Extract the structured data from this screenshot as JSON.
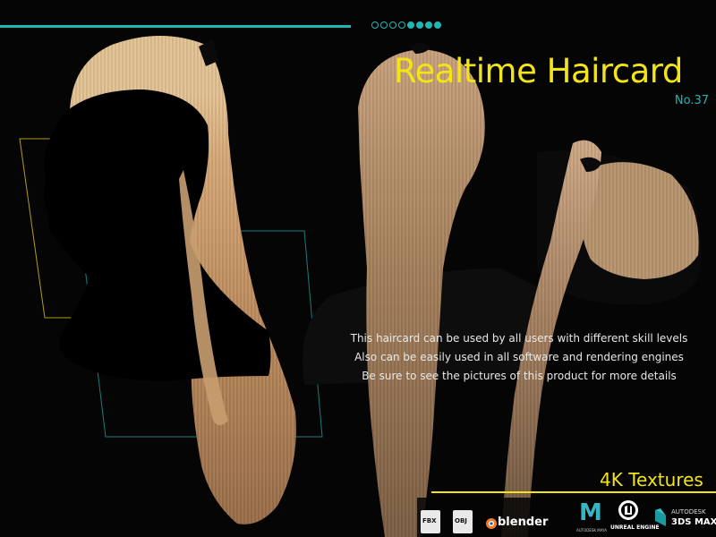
{
  "title": "Realtime Haircard",
  "subtitle": "No.37",
  "progress_dots": {
    "total": 8,
    "filled": 4
  },
  "description": [
    "This haircard can be used by all users with different skill levels",
    "Also can be easily used in all software and rendering engines",
    "Be sure to see the pictures of this product for more details"
  ],
  "badge": "4K Textures",
  "logos": {
    "fbx": "FBX",
    "obj": "OBJ",
    "blender": "blender",
    "maya_letter": "M",
    "maya_caption": "AUTODESK MAYA",
    "unreal_caption": "UNREAL ENGINE",
    "max_top": "AUTODESK",
    "max_bottom": "3DS MAX"
  },
  "colors": {
    "background": "#050505",
    "accent_teal": "#1fb7b3",
    "accent_yellow": "#f2e418",
    "text": "#e8e8e8"
  }
}
